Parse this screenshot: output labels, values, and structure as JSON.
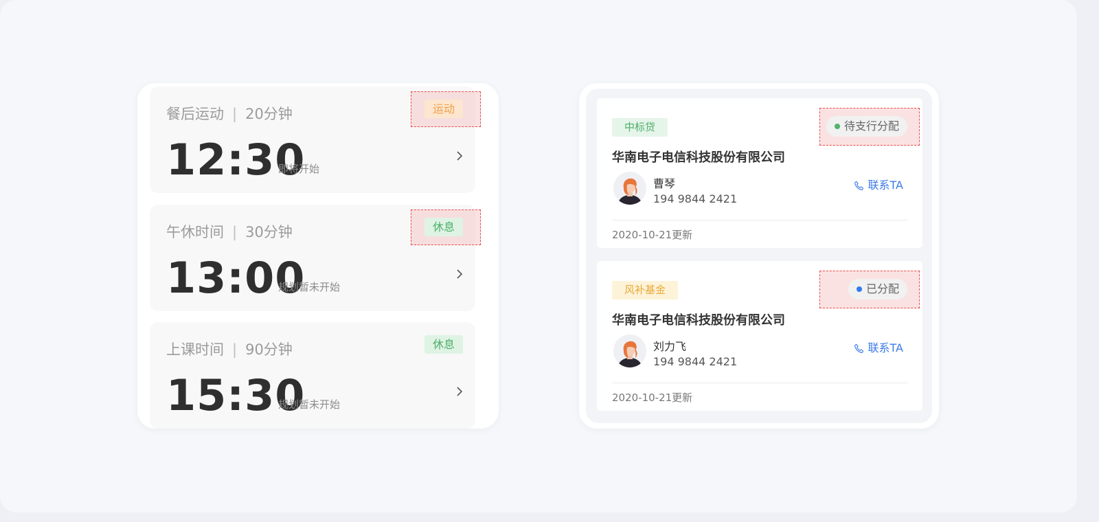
{
  "colors": {
    "tag_exercise_bg": "#fde6cf",
    "tag_exercise_text": "#f0a04b",
    "tag_rest_bg": "#dff3e4",
    "tag_rest_text": "#4caf6a",
    "loan_tag_green_bg": "#e6f5ea",
    "loan_tag_green_text": "#4caf6a",
    "loan_tag_yellow_bg": "#fdf3d8",
    "loan_tag_yellow_text": "#e9a93a",
    "dot_green": "#52b36a",
    "dot_blue": "#2f7bf0",
    "link_blue": "#3b7be8",
    "highlight_red": "#e84b4b"
  },
  "schedule": {
    "items": [
      {
        "title": "餐后运动",
        "separator": "|",
        "duration": "20分钟",
        "tag": "运动",
        "tag_kind": "exercise",
        "time": "12:30",
        "status": "即将开始",
        "highlighted": true
      },
      {
        "title": "午休时间",
        "separator": "|",
        "duration": "30分钟",
        "tag": "休息",
        "tag_kind": "rest",
        "time": "13:00",
        "status": "规划暂未开始",
        "highlighted": true
      },
      {
        "title": "上课时间",
        "separator": "|",
        "duration": "90分钟",
        "tag": "休息",
        "tag_kind": "rest",
        "time": "15:30",
        "status": "规划暂未开始",
        "highlighted": false
      }
    ]
  },
  "loans": {
    "items": [
      {
        "type_tag": "中标贷",
        "type_kind": "green",
        "status": "待支行分配",
        "status_dot": "green",
        "company": "华南电子电信科技股份有限公司",
        "person": "曹琴",
        "phone": "194 9844 2421",
        "contact_label": "联系TA",
        "updated": "2020-10-21更新"
      },
      {
        "type_tag": "风补基金",
        "type_kind": "yellow",
        "status": "已分配",
        "status_dot": "blue",
        "company": "华南电子电信科技股份有限公司",
        "person": "刘力飞",
        "phone": "194 9844 2421",
        "contact_label": "联系TA",
        "updated": "2020-10-21更新"
      }
    ]
  }
}
